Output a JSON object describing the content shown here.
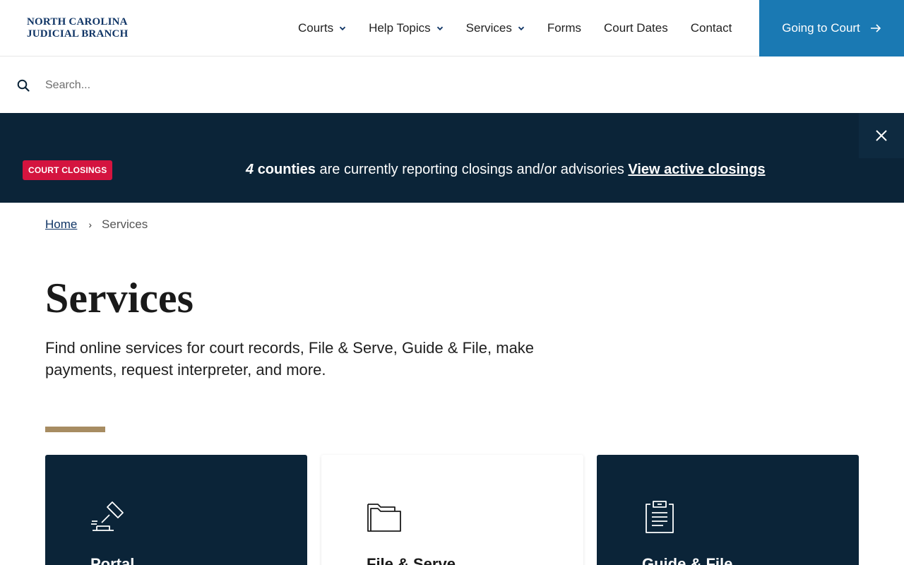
{
  "header": {
    "logo_line1": "NORTH CAROLINA",
    "logo_line2": "JUDICIAL BRANCH",
    "nav": [
      {
        "label": "Courts",
        "has_dropdown": true
      },
      {
        "label": "Help Topics",
        "has_dropdown": true
      },
      {
        "label": "Services",
        "has_dropdown": true
      },
      {
        "label": "Forms",
        "has_dropdown": false
      },
      {
        "label": "Court Dates",
        "has_dropdown": false
      },
      {
        "label": "Contact",
        "has_dropdown": false
      }
    ],
    "cta_label": "Going to Court",
    "cta_color": "#1a79b3"
  },
  "search": {
    "placeholder": "Search...",
    "value": ""
  },
  "alert": {
    "badge": "COURT CLOSINGS",
    "count": "4",
    "counties": "counties",
    "message": "are currently reporting closings and/or advisories",
    "link": "View active closings",
    "background": "#0b2438",
    "badge_color": "#d4143f"
  },
  "breadcrumb": {
    "home": "Home",
    "current": "Services"
  },
  "main": {
    "title": "Services",
    "description": "Find online services for court records, File & Serve, Guide & File, make payments, request interpreter, and more.",
    "accent_color": "#a78c62"
  },
  "cards": [
    {
      "title": "Portal",
      "icon": "gavel-icon",
      "theme": "dark"
    },
    {
      "title": "File & Serve",
      "icon": "folder-icon",
      "theme": "light"
    },
    {
      "title": "Guide & File",
      "icon": "clipboard-icon",
      "theme": "dark"
    }
  ]
}
